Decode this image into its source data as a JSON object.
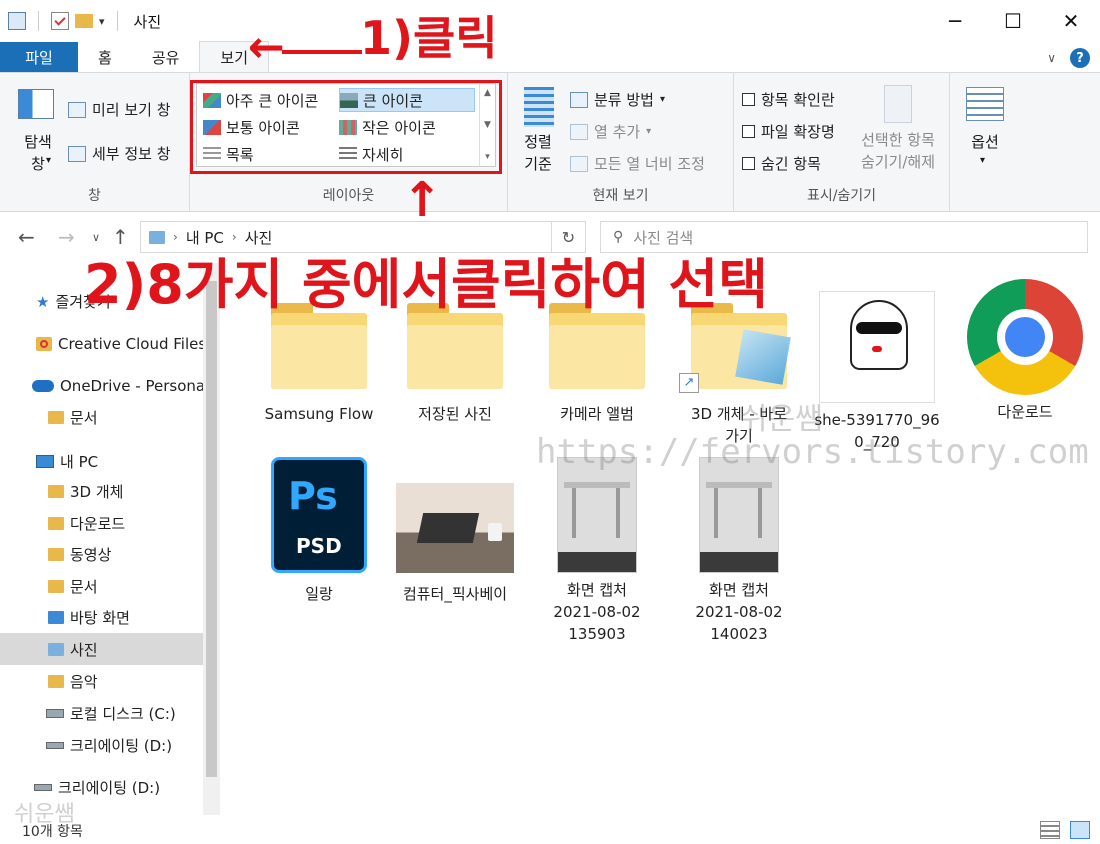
{
  "window": {
    "title": "사진",
    "controls": {
      "minimize": "─",
      "maximize": "☐",
      "close": "✕"
    }
  },
  "tabs": [
    {
      "label": "파일"
    },
    {
      "label": "홈"
    },
    {
      "label": "공유"
    },
    {
      "label": "보기"
    }
  ],
  "ribbon": {
    "pane_group": {
      "nav_pane_button": "탐색\n창",
      "preview_pane": "미리 보기 창",
      "details_pane": "세부 정보 창",
      "label": "창"
    },
    "layout_group": {
      "items": [
        {
          "label": "아주 큰 아이콘",
          "selected": false
        },
        {
          "label": "큰 아이콘",
          "selected": true
        },
        {
          "label": "보통 아이콘",
          "selected": false
        },
        {
          "label": "작은 아이콘",
          "selected": false
        },
        {
          "label": "목록",
          "selected": false
        },
        {
          "label": "자세히",
          "selected": false
        }
      ],
      "label": "레이아웃"
    },
    "current_view_group": {
      "sort_by": "정렬\n기준",
      "group_by": "분류 방법",
      "add_columns": "열 추가",
      "fit_columns": "모든 열 너비 조정",
      "label": "현재 보기"
    },
    "show_hide_group": {
      "item_checkboxes": "항목 확인란",
      "file_extensions": "파일 확장명",
      "hidden_items": "숨긴 항목",
      "hide_selected": "선택한 항목\n숨기기/해제",
      "label": "표시/숨기기"
    },
    "options_group": {
      "options": "옵션"
    }
  },
  "address": {
    "path": [
      "내 PC",
      "사진"
    ],
    "search_placeholder": "사진 검색"
  },
  "nav_pane": [
    {
      "label": "즐겨찾기",
      "icon": "star-icon"
    },
    {
      "label": "Creative Cloud Files",
      "icon": "creative-cloud-icon"
    },
    {
      "label": "OneDrive - Personal",
      "icon": "onedrive-icon"
    },
    {
      "label": "문서",
      "icon": "folder-icon"
    },
    {
      "label": "내 PC",
      "icon": "pc-icon"
    },
    {
      "label": "3D 개체",
      "icon": "folder-icon"
    },
    {
      "label": "다운로드",
      "icon": "folder-icon"
    },
    {
      "label": "동영상",
      "icon": "folder-icon"
    },
    {
      "label": "문서",
      "icon": "folder-icon"
    },
    {
      "label": "바탕 화면",
      "icon": "folder-icon"
    },
    {
      "label": "사진",
      "icon": "folder-icon",
      "selected": true
    },
    {
      "label": "음악",
      "icon": "folder-icon"
    },
    {
      "label": "로컬 디스크 (C:)",
      "icon": "drive-icon"
    },
    {
      "label": "크리에이팅 (D:)",
      "icon": "drive-icon"
    },
    {
      "label": "크리에이팅 (D:)",
      "icon": "drive-icon"
    }
  ],
  "files": [
    {
      "label": "Samsung Flow",
      "kind": "folder"
    },
    {
      "label": "저장된 사진",
      "kind": "folder"
    },
    {
      "label": "카메라 앨범",
      "kind": "folder"
    },
    {
      "label": "3D 개체 - 바로\n가기",
      "kind": "shortcut"
    },
    {
      "label": "she-5391770_96\n0_720",
      "kind": "image"
    },
    {
      "label": "다운로드",
      "kind": "chrome"
    },
    {
      "label": "일랑",
      "kind": "psd",
      "badge_top": "Ps",
      "badge_bottom": "PSD"
    },
    {
      "label": "컴퓨터_픽사베이",
      "kind": "image"
    },
    {
      "label": "화면 캡처\n2021-08-02\n135903",
      "kind": "image"
    },
    {
      "label": "화면 캡처\n2021-08-02\n140023",
      "kind": "image"
    }
  ],
  "status": {
    "count": "10개 항목"
  },
  "annotations": {
    "step1": "1)클릭",
    "step2": "2)8가지 중에서클릭하여 선택",
    "arrow_left": "←",
    "arrow_up": "↑"
  },
  "watermarks": {
    "site": "https://fervors.tistory.com",
    "name1": "쉬운쌤",
    "name2": "쉬운쌤"
  },
  "colors": {
    "accent": "#1a6fb6",
    "annotation": "#e0141b",
    "selection": "#cce4f7"
  }
}
